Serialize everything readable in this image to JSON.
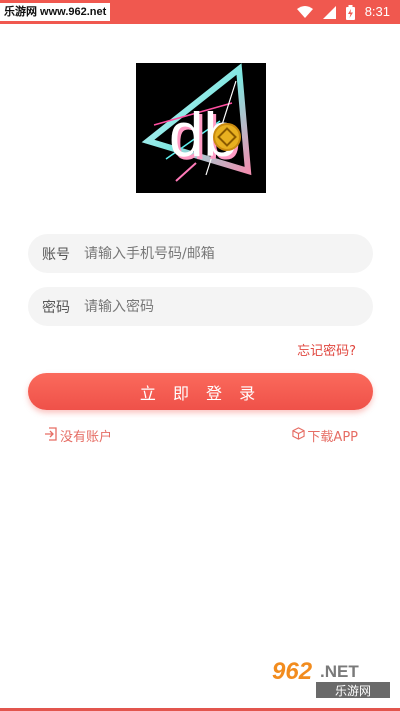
{
  "status_bar": {
    "site_tag": "乐游网 www.962.net",
    "time": "8:31",
    "icons": [
      "wifi-icon",
      "signal-icon",
      "battery-charging-icon"
    ]
  },
  "logo": {
    "text": "db"
  },
  "login_form": {
    "account": {
      "label": "账号",
      "placeholder": "请输入手机号码/邮箱",
      "value": ""
    },
    "password": {
      "label": "密码",
      "placeholder": "请输入密码",
      "value": ""
    },
    "forgot_label": "忘记密码?",
    "submit_label": "立 即 登 录"
  },
  "links": {
    "register_label": "没有账户",
    "register_icon": "exit-arrow-icon",
    "download_label": "下载APP",
    "download_icon": "box-icon"
  },
  "watermark": {
    "top": "962.NET",
    "bottom": "乐游网"
  },
  "colors": {
    "accent": "#f0584f",
    "link": "#e66d64",
    "input_bg": "#f4f4f4"
  }
}
